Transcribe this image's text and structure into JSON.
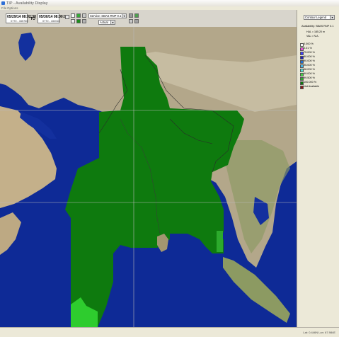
{
  "window": {
    "title": "TIP - Availability Display"
  },
  "menubar": {
    "items": [
      "File",
      "Options"
    ]
  },
  "toolbar": {
    "start_date": "05/29/14 08:02:30",
    "start_sub": "0770 - 345760",
    "to_label": "TO",
    "end_date": "05/30/14 08:00:00",
    "end_sub": "0770 - 432016",
    "service": "Service: SBAS RNP 0.1",
    "mode": "Actual"
  },
  "panel": {
    "view_select": "Contour Legend",
    "availability_label": "Availability: SBAS RNP 0.1",
    "hal": "HAL = 185.20 m",
    "val": "VAL = N.A.",
    "legend": [
      {
        "label": "0.000 %",
        "color": "#f5f5f5"
      },
      {
        "label": "0.01 %",
        "color": "#e64bd8"
      },
      {
        "label": "75.000 %",
        "color": "#3c3cff"
      },
      {
        "label": "80.000 %",
        "color": "#2222b4"
      },
      {
        "label": "90.000 %",
        "color": "#1e6ed2"
      },
      {
        "label": "95.000 %",
        "color": "#46b4e6"
      },
      {
        "label": "98.000 %",
        "color": "#5ae6d2"
      },
      {
        "label": "99.000 %",
        "color": "#46d446"
      },
      {
        "label": "99.500 %",
        "color": "#2caa2c"
      },
      {
        "label": "100.000 %",
        "color": "#0e7a0e"
      },
      {
        "label": "Not Available",
        "color": "#8a1a1a"
      }
    ]
  },
  "status": {
    "coords": "Lat: 0.446N  Lon: 67.984E"
  }
}
